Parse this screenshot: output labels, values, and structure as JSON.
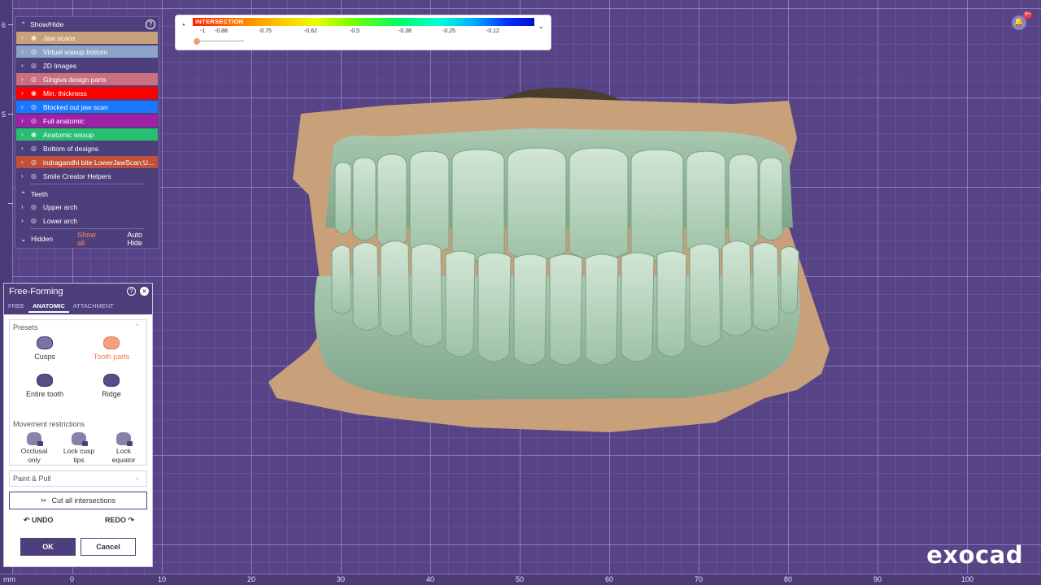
{
  "showhide": {
    "title": "Show/Hide",
    "help": "?",
    "items": [
      {
        "label": "Jaw scans",
        "color": "#c8a07a",
        "visible": true
      },
      {
        "label": "Virtual waxup bottom",
        "color": "#8da4c6",
        "visible": false
      },
      {
        "label": "2D Images",
        "color": "",
        "visible": false
      },
      {
        "label": "Gingiva design parts",
        "color": "#cc7080",
        "visible": false
      },
      {
        "label": "Min. thickness",
        "color": "#ff0000",
        "visible": true
      },
      {
        "label": "Blocked out jaw scan",
        "color": "#1a78ff",
        "visible": false
      },
      {
        "label": "Full anatomic",
        "color": "#a020a8",
        "visible": false
      },
      {
        "label": "Anatomic waxup",
        "color": "#28c070",
        "visible": true
      },
      {
        "label": "Bottom of designs",
        "color": "",
        "visible": false
      },
      {
        "label": "indragandhi bite LowerJawScan;U...",
        "color": "#c0503a",
        "visible": false
      },
      {
        "label": "Smile Creator Helpers",
        "color": "",
        "visible": false
      }
    ],
    "teeth_section": "Teeth",
    "teeth_items": [
      {
        "label": "Upper arch"
      },
      {
        "label": "Lower arch"
      }
    ],
    "hidden_label": "Hidden",
    "show_all": "Show all",
    "auto_hide": "Auto Hide"
  },
  "intersection": {
    "title": "INTERSECTION",
    "ticks": [
      "-1",
      "-0.88",
      "-0.75",
      "-0.62",
      "-0.5",
      "-0.38",
      "-0.25",
      "-0.12"
    ],
    "slider_value": -1
  },
  "notifications": {
    "badge": "9+"
  },
  "freeforming": {
    "title": "Free-Forming",
    "help": "?",
    "tabs": [
      "FREE",
      "ANATOMIC",
      "ATTACHMENT"
    ],
    "active_tab": "ANATOMIC",
    "presets_title": "Presets",
    "presets": [
      "Cusps",
      "Tooth parts",
      "Entire tooth",
      "Ridge"
    ],
    "movement_title": "Movement restrictions",
    "movement": [
      "Occlusal\nonly",
      "Lock cusp\ntips",
      "Lock\nequator"
    ],
    "movement_lines": [
      [
        "Occlusal",
        "only"
      ],
      [
        "Lock cusp",
        "tips"
      ],
      [
        "Lock",
        "equator"
      ]
    ],
    "paint_pull": "Paint & Pull",
    "cut_intersections": "Cut all intersections",
    "undo": "UNDO",
    "redo": "REDO",
    "ok": "OK",
    "cancel": "Cancel"
  },
  "ruler": {
    "unit": "mm",
    "bottom_labels": [
      "0",
      "10",
      "20",
      "30",
      "40",
      "50",
      "60",
      "70",
      "80",
      "90",
      "100"
    ],
    "left_labels": [
      "6",
      "5"
    ]
  },
  "brand": {
    "logo": "exocad"
  }
}
